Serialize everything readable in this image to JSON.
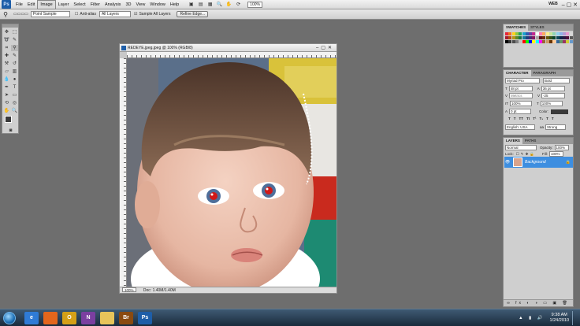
{
  "app": {
    "logo": "Ps"
  },
  "menu": [
    "File",
    "Edit",
    "Image",
    "Layer",
    "Select",
    "Filter",
    "Analysis",
    "3D",
    "View",
    "Window",
    "Help"
  ],
  "menu_active": "Image",
  "menubar_right": {
    "zoom": "100%",
    "workspace": "WEB"
  },
  "options": {
    "sample_size": "Point Sample",
    "anti_alias": "Anti-alias",
    "layers": "All Layers",
    "sample_all": "Sample All Layers",
    "refine": "Refine Edge..."
  },
  "document": {
    "title": "REDEYE.jpeg.jpeg @ 100% (RGB/8)",
    "zoom": "100%",
    "doc_size": "Doc: 1.40M/1.40M"
  },
  "swatches_panel": {
    "tabs": [
      "SWATCHES",
      "STYLES"
    ]
  },
  "swatch_colors": [
    "#e6263a",
    "#f3711c",
    "#ffd21a",
    "#8dc63f",
    "#1fa25a",
    "#19a4ce",
    "#2a5db0",
    "#6a3aa0",
    "#c1268f",
    "#ffffff",
    "#ff7bac",
    "#ffa85c",
    "#fff08a",
    "#c8e59a",
    "#8fd6b3",
    "#8fd2ee",
    "#8fb2e8",
    "#b49ad6",
    "#e89ad0",
    "#d9d9d9",
    "#a6192e",
    "#b34d0f",
    "#b59613",
    "#5c8a29",
    "#17754a",
    "#157a98",
    "#1c3f7d",
    "#482873",
    "#85175f",
    "#a6a6a6",
    "#5f0f1a",
    "#6a2c09",
    "#6b590a",
    "#365118",
    "#0d452b",
    "#0c4859",
    "#10254a",
    "#2a1744",
    "#4e0e38",
    "#595959",
    "#000000",
    "#333333",
    "#4d4d4d",
    "#808080",
    "#c0c0c0",
    "#ff0000",
    "#00ff00",
    "#0000ff",
    "#ffff00",
    "#00ffff",
    "#ff00ff",
    "#996633",
    "#cc9966",
    "#663300",
    "#ffcc99",
    "#336699",
    "#669966",
    "#993366",
    "#cccc33",
    "#6699cc"
  ],
  "character_panel": {
    "tabs": [
      "CHARACTER",
      "PARAGRAPH"
    ],
    "font": "Myriad Pro",
    "style": "Bold",
    "size": "48 pt",
    "leading": "36 pt",
    "kerning": "Metrics",
    "tracking": "-25",
    "vscale": "100%",
    "hscale": "100%",
    "baseline": "0 pt",
    "color_label": "Color:",
    "styles": [
      "T",
      "T",
      "TT",
      "Tt",
      "T¹",
      "T₁",
      "T",
      "T"
    ],
    "language": "English: USA",
    "aa_label": "aa",
    "antialias": "Strong"
  },
  "layers_panel": {
    "tabs": [
      "LAYERS",
      "PATHS"
    ],
    "blend": "Normal",
    "opacity_label": "Opacity:",
    "opacity": "100%",
    "lock_label": "Lock:",
    "fill_label": "Fill:",
    "fill": "100%",
    "layer_name": "Background"
  },
  "taskbar": {
    "time": "9:38 AM",
    "date": "1/24/2010"
  },
  "taskbar_apps": [
    {
      "name": "ie-icon",
      "label": "e",
      "color": "#2f7bd6"
    },
    {
      "name": "firefox-icon",
      "label": "",
      "color": "#e3661c"
    },
    {
      "name": "outlook-icon",
      "label": "O",
      "color": "#d4a017"
    },
    {
      "name": "onenote-icon",
      "label": "N",
      "color": "#7b3fa0"
    },
    {
      "name": "folder-icon",
      "label": "",
      "color": "#e8c45a"
    },
    {
      "name": "bridge-icon",
      "label": "Br",
      "color": "#8a4a10"
    },
    {
      "name": "photoshop-icon",
      "label": "Ps",
      "color": "#1e5ea8"
    }
  ]
}
